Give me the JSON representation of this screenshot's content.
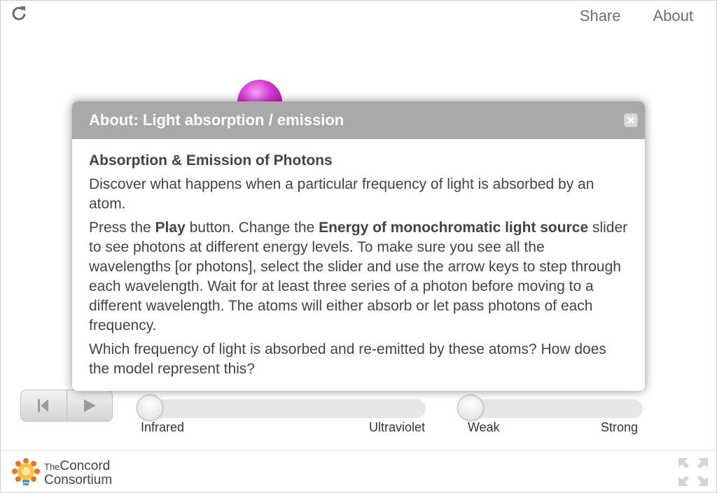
{
  "topnav": {
    "share": "Share",
    "about": "About"
  },
  "icons": {
    "reload": "reload-icon",
    "close": "close-icon",
    "fullscreen": "fullscreen-icon",
    "step_back": "step-back-icon",
    "play": "play-icon"
  },
  "controls": {
    "energy_slider": {
      "min_label": "Infrared",
      "max_label": "Ultraviolet",
      "value": 0
    },
    "intensity_slider": {
      "min_label": "Weak",
      "max_label": "Strong",
      "value": 0
    }
  },
  "dialog": {
    "title": "About: Light absorption / emission",
    "heading": "Absorption & Emission of Photons",
    "p1": "Discover what happens when a particular frequency of light is absorbed by an atom.",
    "p2_a": "Press the ",
    "p2_play": "Play",
    "p2_b": " button. Change the ",
    "p2_slider": "Energy of monochromatic light source",
    "p2_c": " slider to see photons at different energy levels. To make sure you see all the wavelengths [or photons], select the slider and use the arrow keys to step through each wavelength. Wait for at least three series of a photon before moving to a different wavelength. The atoms will either absorb or let pass photons of each frequency.",
    "p3": "Which frequency of light is absorbed and re-emitted by these atoms? How does the model represent this?"
  },
  "footer": {
    "logo_line1_small": "The",
    "logo_line1": "Concord",
    "logo_line2": "Consortium"
  },
  "colors": {
    "dialog_header": "#a9a9a9",
    "atom": "#c22bbe",
    "logo_orange": "#e8742a",
    "logo_bulb": "#f5c542"
  }
}
